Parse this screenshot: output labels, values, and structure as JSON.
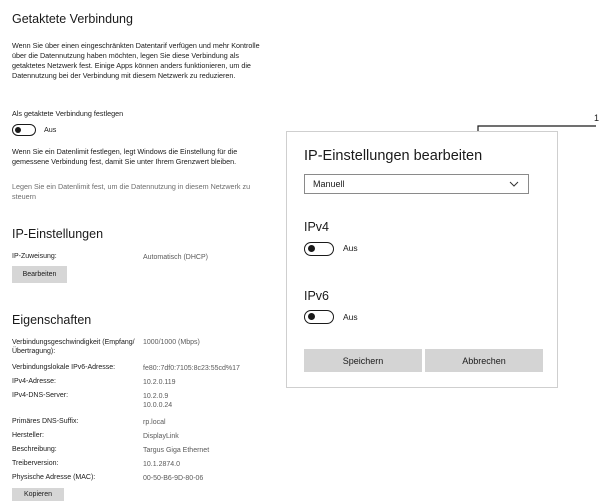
{
  "metered": {
    "title": "Getaktete Verbindung",
    "description": "Wenn Sie über einen eingeschränkten Datentarif verfügen und mehr Kontrolle über die Datennutzung haben möchten, legen Sie diese Verbindung als getaktetes Netzwerk fest. Einige Apps können anders funktionieren, um die Datennutzung bei der Verbindung mit diesem Netzwerk zu reduzieren.",
    "toggle_label": "Als getaktete Verbindung festlegen",
    "toggle_state": "Aus",
    "limit_text": "Wenn Sie ein Datenlimit festlegen, legt Windows die Einstellung für die gemessene Verbindung fest, damit Sie unter Ihrem Grenzwert bleiben.",
    "limit_link": "Legen Sie ein Datenlimit fest, um die Datennutzung in diesem Netzwerk zu steuern"
  },
  "ip_settings": {
    "title": "IP-Einstellungen",
    "assignment_label": "IP-Zuweisung:",
    "assignment_value": "Automatisch (DHCP)",
    "edit_button": "Bearbeiten"
  },
  "properties": {
    "title": "Eigenschaften",
    "rows": [
      {
        "label": "Verbindungsgeschwindigkeit (Empfang/Übertragung):",
        "value": "1000/1000 (Mbps)"
      },
      {
        "label": "Verbindungslokale IPv6-Adresse:",
        "value": "fe80::7df0:7105:8c23:55cd%17"
      },
      {
        "label": "IPv4-Adresse:",
        "value": "10.2.0.119"
      },
      {
        "label": "IPv4-DNS-Server:",
        "value": "10.2.0.9",
        "value2": "10.0.0.24"
      },
      {
        "label": "Primäres DNS-Suffix:",
        "value": "rp.local"
      },
      {
        "label": "Hersteller:",
        "value": "DisplayLink"
      },
      {
        "label": "Beschreibung:",
        "value": "Targus Giga Ethernet"
      },
      {
        "label": "Treiberversion:",
        "value": "10.1.2874.0"
      },
      {
        "label": "Physische Adresse (MAC):",
        "value": "00-50-B6-9D-80-06"
      }
    ],
    "copy_button": "Kopieren"
  },
  "dialog": {
    "title": "IP-Einstellungen bearbeiten",
    "select_value": "Manuell",
    "ipv4_heading": "IPv4",
    "ipv4_toggle_state": "Aus",
    "ipv6_heading": "IPv6",
    "ipv6_toggle_state": "Aus",
    "save_button": "Speichern",
    "cancel_button": "Abbrechen"
  },
  "callout": {
    "label": "1"
  },
  "icons": {
    "select_arrow": "chevron-down-icon"
  }
}
